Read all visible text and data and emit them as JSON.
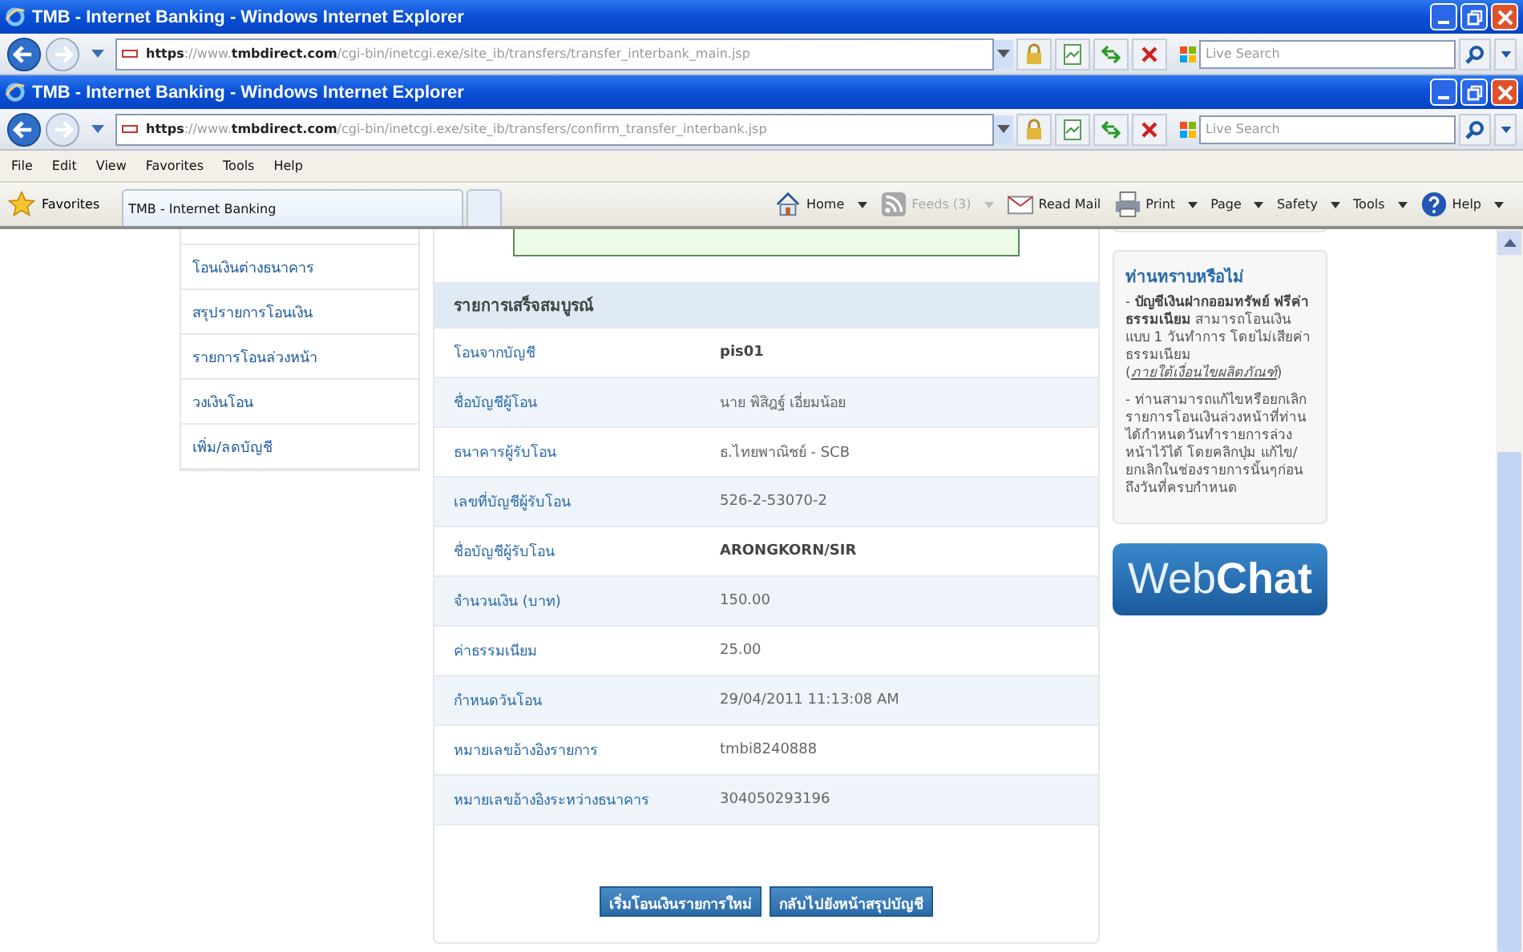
{
  "windows": [
    {
      "title": "TMB - Internet Banking - Windows Internet Explorer",
      "url": "**https**://www.**tmbdirect.com**/cgi-bin/inetcgi.exe/site_ib/transfers/transfer_interbank_main.jsp",
      "search": {
        "placeholder": "Live Search"
      }
    },
    {
      "title": "TMB - Internet Banking - Windows Internet Explorer",
      "url": "**https**://www.**tmbdirect.com**/cgi-bin/inetcgi.exe/site_ib/transfers/confirm_transfer_interbank.jsp",
      "search": {
        "placeholder": "Live Search"
      }
    }
  ],
  "menu": [
    "File",
    "Edit",
    "View",
    "Favorites",
    "Tools",
    "Help"
  ],
  "favorites": {
    "label": "Favorites",
    "tabs": [
      {
        "label": "TMB - Internet Banking",
        "selected": true
      }
    ]
  },
  "command_bar": [
    {
      "kind": "home",
      "label": "Home",
      "dropdown": true,
      "disabled": false
    },
    {
      "kind": "feeds",
      "label": "Feeds (3)",
      "dropdown": true,
      "disabled": true
    },
    {
      "kind": "mail",
      "label": "Read Mail",
      "dropdown": false,
      "disabled": false
    },
    {
      "kind": "print",
      "label": "Print",
      "dropdown": true,
      "disabled": false
    },
    {
      "kind": "text",
      "label": "Page",
      "dropdown": true,
      "disabled": false
    },
    {
      "kind": "text",
      "label": "Safety",
      "dropdown": true,
      "disabled": false
    },
    {
      "kind": "text",
      "label": "Tools",
      "dropdown": true,
      "disabled": false
    },
    {
      "kind": "help",
      "label": "Help",
      "dropdown": true,
      "disabled": false
    }
  ],
  "sidebar": {
    "items": [
      "โอนเงินต่างธนาคาร",
      "สรุปรายการโอนเงิน",
      "รายการโอนล่วงหน้า",
      "วงเงินโอน",
      "เพิ่ม/ลดบัญชี"
    ]
  },
  "result": {
    "heading": "รายการเสร็จสมบูรณ์",
    "rows": [
      {
        "label": "โอนจากบัญชี",
        "value": "pis01",
        "bold": true
      },
      {
        "label": "ชื่อบัญชีผู้โอน",
        "value": "นาย พิสิฎฐ์ เอี่ยมน้อย",
        "bold": false
      },
      {
        "label": "ธนาคารผู้รับโอน",
        "value": "ธ.ไทยพาณิชย์ - SCB",
        "bold": false
      },
      {
        "label": "เลขที่บัญชีผู้รับโอน",
        "value": "526-2-53070-2",
        "bold": false
      },
      {
        "label": "ชื่อบัญชีผู้รับโอน",
        "value": "ARONGKORN/SIR",
        "bold": true
      },
      {
        "label": "จำนวนเงิน (บาท)",
        "value": "150.00",
        "bold": false
      },
      {
        "label": "ค่าธรรมเนียม",
        "value": "25.00",
        "bold": false
      },
      {
        "label": "กำหนดวันโอน",
        "value": "29/04/2011 11:13:08 AM",
        "bold": false
      },
      {
        "label": "หมายเลขอ้างอิงรายการ",
        "value": "tmbi8240888",
        "bold": false
      },
      {
        "label": "หมายเลขอ้างอิงระหว่างธนาคาร",
        "value": "304050293196",
        "bold": false
      }
    ],
    "buttons": [
      "เริ่มโอนเงินรายการใหม่",
      "กลับไปยังหน้าสรุปบัญชี"
    ]
  },
  "info": {
    "title": "ท่านทราบหรือไม่",
    "tip_1": {
      "text": "- **บัญชีเงินฝากออมทรัพย์ ฟรีค่าธรรมเนียม** สามารถโอนเงินแบบ 1 วันทำการ โดยไม่เสียค่าธรรมเนียม (",
      "link": "ภายใต้เงื่อนไขผลิตภัณฑ์",
      "after": ")"
    },
    "tip_2": "- ท่านสามารถแก้ไขหรือยกเลิก รายการโอนเงินล่วงหน้าที่ท่านได้กำหนดวันทำรายการล่วงหน้าไว้ได้ โดยคลิกปุ่ม แก้ไข/ยกเลิกในช่องรายการนั้นๆก่อนถึงวันที่ครบกำหนด"
  },
  "webchat": {
    "text": "Web**Chat**"
  }
}
